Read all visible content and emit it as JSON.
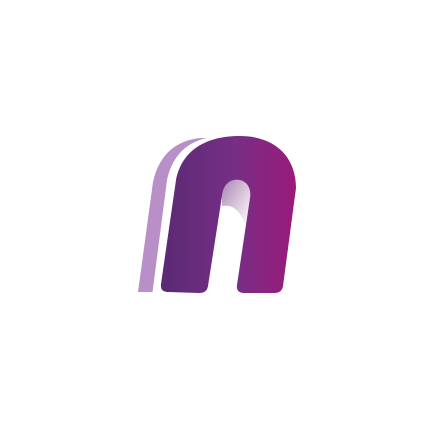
{
  "logo": {
    "icon": "n-monogram-logo",
    "colors": {
      "background": "#ffffff",
      "shadow_layer": "#b98fc7",
      "gap_layer": "#ffffff",
      "main_start": "#5a2a73",
      "main_mid": "#772e86",
      "main_end": "#9a1a7a"
    }
  }
}
